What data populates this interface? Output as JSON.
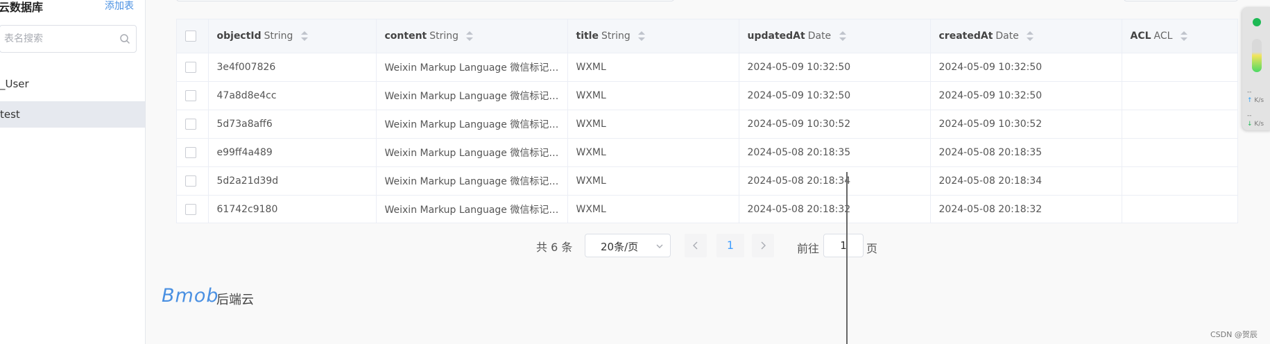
{
  "sidebar": {
    "title": "云数据库",
    "add_label": "添加表",
    "search_placeholder": "表名搜索",
    "items": [
      {
        "label": "_User",
        "active": false
      },
      {
        "label": "test",
        "active": true
      }
    ]
  },
  "table": {
    "columns": [
      {
        "name": "objectId",
        "type": "String"
      },
      {
        "name": "content",
        "type": "String"
      },
      {
        "name": "title",
        "type": "String"
      },
      {
        "name": "updatedAt",
        "type": "Date"
      },
      {
        "name": "createdAt",
        "type": "Date"
      },
      {
        "name": "ACL",
        "type": "ACL"
      }
    ],
    "rows": [
      {
        "objectId": "3e4f007826",
        "content": "Weixin Markup Language 微信标记语言",
        "title": "WXML",
        "updatedAt": "2024-05-09 10:32:50",
        "createdAt": "2024-05-09 10:32:50",
        "acl": ""
      },
      {
        "objectId": "47a8d8e4cc",
        "content": "Weixin Markup Language 微信标记语言",
        "title": "WXML",
        "updatedAt": "2024-05-09 10:32:50",
        "createdAt": "2024-05-09 10:32:50",
        "acl": ""
      },
      {
        "objectId": "5d73a8aff6",
        "content": "Weixin Markup Language 微信标记语言",
        "title": "WXML",
        "updatedAt": "2024-05-09 10:30:52",
        "createdAt": "2024-05-09 10:30:52",
        "acl": ""
      },
      {
        "objectId": "e99ff4a489",
        "content": "Weixin Markup Language 微信标记语言",
        "title": "WXML",
        "updatedAt": "2024-05-08 20:18:35",
        "createdAt": "2024-05-08 20:18:35",
        "acl": ""
      },
      {
        "objectId": "5d2a21d39d",
        "content": "Weixin Markup Language 微信标记语言",
        "title": "WXML",
        "updatedAt": "2024-05-08 20:18:34",
        "createdAt": "2024-05-08 20:18:34",
        "acl": ""
      },
      {
        "objectId": "61742c9180",
        "content": "Weixin Markup Language 微信标记语言",
        "title": "WXML",
        "updatedAt": "2024-05-08 20:18:32",
        "createdAt": "2024-05-08 20:18:32",
        "acl": ""
      }
    ]
  },
  "pagination": {
    "total_label": "共 6 条",
    "page_size_label": "20条/页",
    "current_page": "1",
    "goto_label": "前往",
    "goto_value": "1",
    "page_suffix": "页"
  },
  "brand": {
    "logo_text": "Bmob",
    "subtitle": "后端云"
  },
  "monitor": {
    "up_value": "--",
    "up_unit": "K/s",
    "down_value": "--",
    "down_unit": "K/s"
  },
  "watermark": "CSDN @贺辰",
  "colors": {
    "accent": "#409eff",
    "brand_blue": "#4a90e2",
    "monitor_ok": "#1db954"
  }
}
